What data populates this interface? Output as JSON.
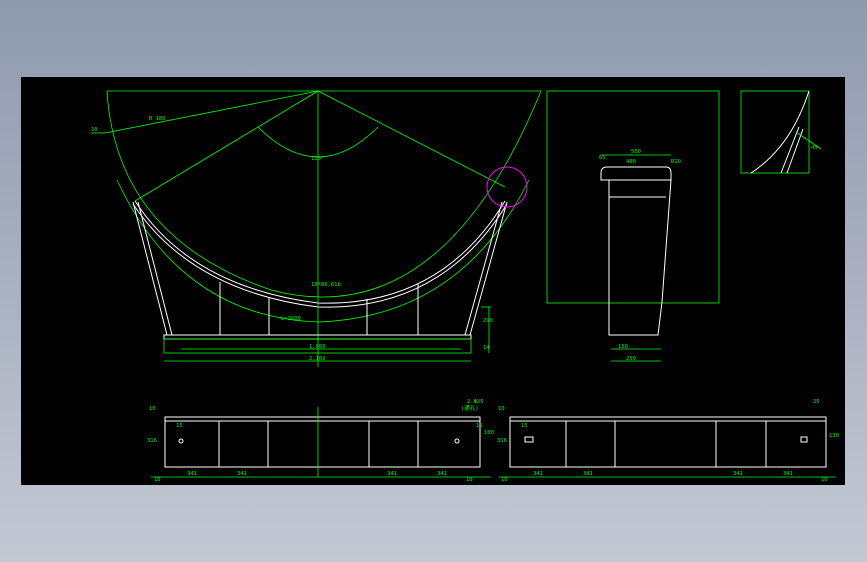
{
  "labels": {
    "radius": "R_180",
    "r_small": "10",
    "angle": "120°",
    "arc_len": "L=3600",
    "note": "10*80,61b",
    "width_inner": "1,960",
    "width_outer": "2,160",
    "height_a": "290",
    "height_b": "14",
    "side_top": "500",
    "side_a": "65",
    "side_b": "400",
    "side_c": "R10",
    "side_base_a": "150",
    "side_base_b": "250",
    "detail_angle": "45",
    "e1_dim_a": "10",
    "e1_dim_b": "15",
    "e1_dim_c": "316",
    "e1_spacing": "341",
    "e1_edge": "10",
    "e1_right_a": "2-Φ25",
    "e1_right_b": "(通孔)",
    "e1_right_c": "15",
    "e1_right_d": "100",
    "e2_top": "25",
    "e2_left_a": "10",
    "e2_left_b": "15",
    "e2_left_c": "316",
    "e2_right_a": "130"
  },
  "colors": {
    "lines": "#00ff00",
    "parts": "#ffffff",
    "background": "#000000",
    "marker": "#ff00ff"
  }
}
